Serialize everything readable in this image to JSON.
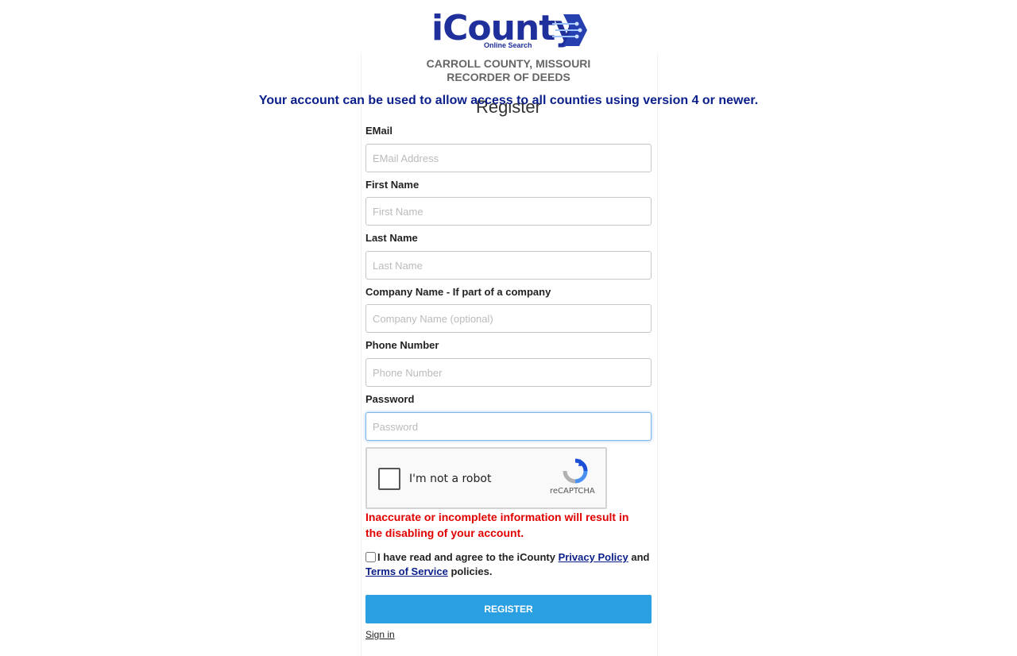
{
  "logo": {
    "text": "iCounty",
    "subtitle": "Online Search"
  },
  "county": {
    "line1": "CARROLL COUNTY, MISSOURI",
    "line2": "RECORDER OF DEEDS"
  },
  "heading": "Register",
  "notice": "Your account can be used to allow access to all counties using version 4 or newer.",
  "fields": [
    {
      "label": "EMail",
      "placeholder": "EMail Address"
    },
    {
      "label": "First Name",
      "placeholder": "First Name"
    },
    {
      "label": "Last Name",
      "placeholder": "Last Name"
    },
    {
      "label": "Company Name - If part of a company",
      "placeholder": "Company Name (optional)"
    },
    {
      "label": "Phone Number",
      "placeholder": "Phone Number"
    },
    {
      "label": "Password",
      "placeholder": "Password"
    }
  ],
  "captcha": {
    "label": "I'm not a robot",
    "brand": "reCAPTCHA"
  },
  "warning": "Inaccurate or incomplete information will result in the disabling of your account.",
  "agreement": {
    "prefix": "I have read and agree to the iCounty",
    "privacy_link": "Privacy Policy",
    "middle": "and",
    "terms_link": "Terms of Service",
    "suffix": "policies."
  },
  "register_button": "REGISTER",
  "signin_link": "Sign in",
  "colors": {
    "brand": "#1f2f9b",
    "button": "#2a9fe2",
    "warning": "#e00000",
    "notice": "#0b1f8a"
  }
}
